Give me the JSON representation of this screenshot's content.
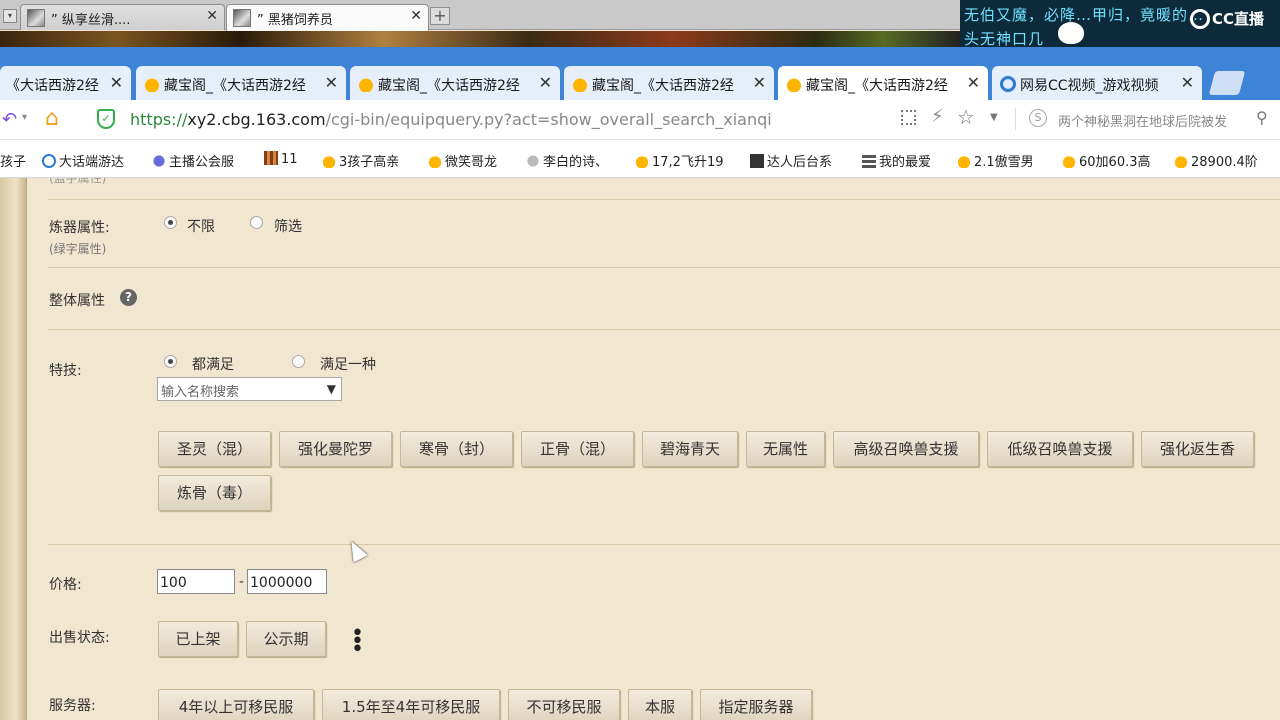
{
  "outer_tabs": [
    {
      "label": "” 纵享丝滑....",
      "active": false
    },
    {
      "label": "” 黑猪饲养员",
      "active": true
    }
  ],
  "cc_overlay": {
    "text_line1": "无伯又魔，必降…甲归，竟暖的…",
    "text_line2": "头无神口几",
    "logo": "CC直播"
  },
  "browser_tabs": [
    {
      "label": "《大话西游2经",
      "icon": "chick-icon",
      "active": false
    },
    {
      "label": "藏宝阁_《大话西游2经",
      "icon": "chick-icon",
      "active": false
    },
    {
      "label": "藏宝阁_《大话西游2经",
      "icon": "chick-icon",
      "active": false
    },
    {
      "label": "藏宝阁_《大话西游2经",
      "icon": "chick-icon",
      "active": false
    },
    {
      "label": "藏宝阁_《大话西游2经",
      "icon": "chick-icon",
      "active": true
    },
    {
      "label": "网易CC视频_游戏视频",
      "icon": "cc-icon",
      "active": false
    }
  ],
  "address": {
    "protocol": "https://",
    "host": "xy2.cbg.163.com",
    "path": "/cgi-bin/equipquery.py?act=show_overall_search_xianqi",
    "search_hint": "两个神秘黑洞在地球后院被发"
  },
  "bookmarks": [
    {
      "label": "孩子",
      "icon": "none"
    },
    {
      "label": "大话端游达",
      "icon": "blue-c-icon"
    },
    {
      "label": "主播公会服",
      "icon": "purple-icon"
    },
    {
      "label": "11",
      "icon": "mosaic-icon"
    },
    {
      "label": "3孩子高亲",
      "icon": "chick-icon"
    },
    {
      "label": "微笑哥龙",
      "icon": "chick-icon"
    },
    {
      "label": "李白的诗、",
      "icon": "grey-icon"
    },
    {
      "label": "17,2飞升19",
      "icon": "chick-icon"
    },
    {
      "label": "达人后台系",
      "icon": "dark-icon"
    },
    {
      "label": "我的最爱",
      "icon": "grid-icon"
    },
    {
      "label": "2.1傲雪男",
      "icon": "chick-icon"
    },
    {
      "label": "60加60.3高",
      "icon": "chick-icon"
    },
    {
      "label": "28900.4阶",
      "icon": "chick-icon"
    }
  ],
  "form": {
    "top_sublabel": "(蓝字属性)",
    "refine": {
      "label": "炼器属性:",
      "sublabel": "(绿字属性)",
      "options": [
        "不限",
        "筛选"
      ],
      "selected": "不限"
    },
    "overall": {
      "label": "整体属性"
    },
    "skills": {
      "label": "特技:",
      "mode_options": [
        "都满足",
        "满足一种"
      ],
      "mode_selected": "都满足",
      "search_placeholder": "输入名称搜索",
      "chips": [
        "圣灵（混）",
        "强化曼陀罗",
        "寒骨（封）",
        "正骨（混）",
        "碧海青天",
        "无属性",
        "高级召唤兽支援",
        "低级召唤兽支援",
        "强化返生香",
        "炼骨（毒）"
      ]
    },
    "price": {
      "label": "价格:",
      "min": "100",
      "dash": "-",
      "max": "1000000"
    },
    "sale_status": {
      "label": "出售状态:",
      "options": [
        "已上架",
        "公示期"
      ]
    },
    "server": {
      "label": "服务器:",
      "options": [
        "4年以上可移民服",
        "1.5年至4年可移民服",
        "不可移民服",
        "本服",
        "指定服务器"
      ]
    }
  }
}
